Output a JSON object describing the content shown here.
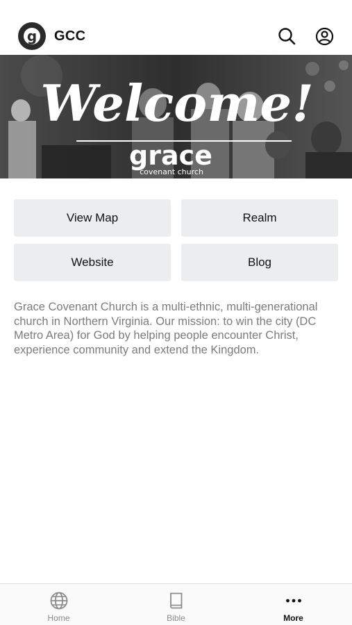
{
  "header": {
    "logo_letter": "g",
    "title": "GCC",
    "icons": [
      "search-icon",
      "account-icon"
    ]
  },
  "banner": {
    "headline": "Welcome!",
    "brand": "grace",
    "brand_sub": "covenant church"
  },
  "buttons": {
    "view_map": "View Map",
    "realm": "Realm",
    "website": "Website",
    "blog": "Blog"
  },
  "description": "Grace Covenant Church is a multi-ethnic, multi-generational church in Northern Virginia. Our mission: to win the city (DC Metro Area) for God by helping people encounter Christ, experience community and extend the Kingdom.",
  "tabbar": {
    "items": [
      {
        "label": "Home",
        "icon": "globe-icon",
        "active": false
      },
      {
        "label": "Bible",
        "icon": "book-icon",
        "active": false
      },
      {
        "label": "More",
        "icon": "more-icon",
        "active": true
      }
    ]
  },
  "colors": {
    "button_bg": "#ebedef",
    "text_muted": "#7b7b7b",
    "logo_dark": "#2b2b2b"
  }
}
